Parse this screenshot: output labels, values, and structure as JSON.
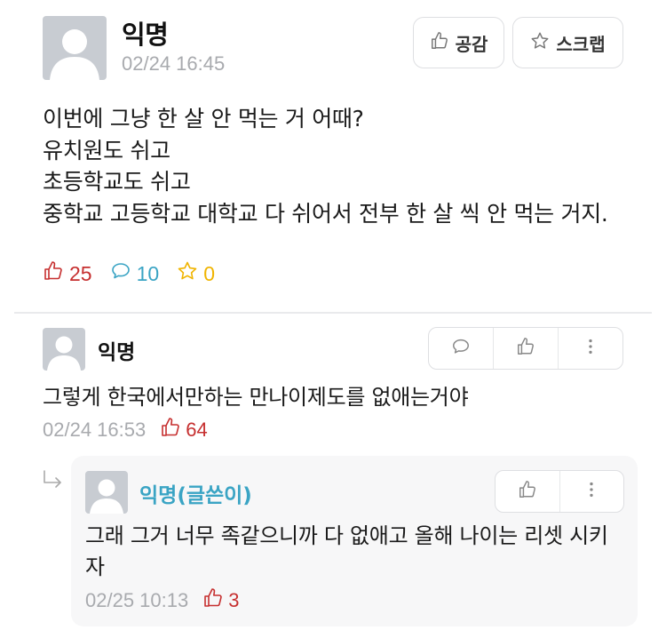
{
  "post": {
    "author": "익명",
    "date": "02/24 16:45",
    "like_button": "공감",
    "scrap_button": "스크랩",
    "body": "이번에 그냥 한 살 안 먹는 거 어때?\n유치원도 쉬고\n초등학교도 쉬고\n중학교 고등학교 대학교 다 쉬어서 전부 한 살 씩 안 먹는 거지.",
    "stats": {
      "likes": "25",
      "comments": "10",
      "scraps": "0"
    }
  },
  "comment": {
    "author": "익명",
    "text": "그렇게 한국에서만하는 만나이제도를 없애는거야",
    "date": "02/24 16:53",
    "likes": "64"
  },
  "reply": {
    "author": "익명(글쓴이)",
    "text": "그래 그거 너무 족같으니까 다 없애고 올해 나이는 리셋 시키자",
    "date": "02/25 10:13",
    "likes": "3"
  },
  "colors": {
    "like": "#c62f2f",
    "comment": "#3aa4c4",
    "scrap": "#f0b400",
    "writer": "#3aa4c4",
    "muted": "#a8aaae"
  }
}
